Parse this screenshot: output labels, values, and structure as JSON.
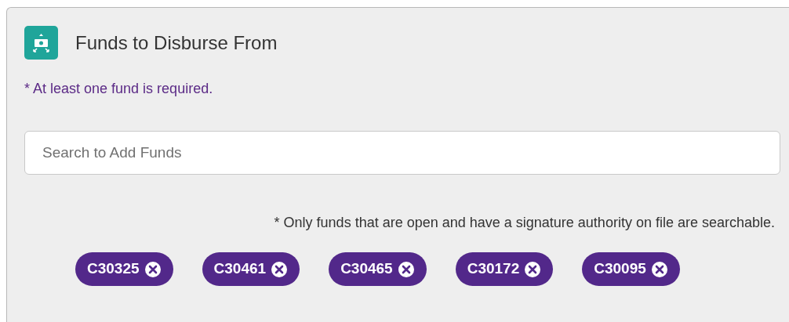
{
  "card": {
    "title": "Funds to Disburse From"
  },
  "required_note": "* At least one fund is required.",
  "search": {
    "placeholder": "Search to Add Funds"
  },
  "search_note": "* Only funds that are open and have a signature authority on file are searchable.",
  "funds": [
    {
      "label": "C30325"
    },
    {
      "label": "C30461"
    },
    {
      "label": "C30465"
    },
    {
      "label": "C30172"
    },
    {
      "label": "C30095"
    }
  ]
}
